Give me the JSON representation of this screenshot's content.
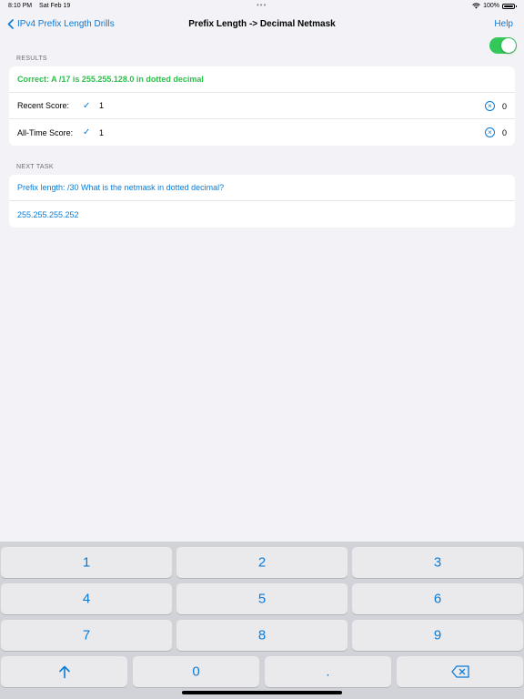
{
  "status_bar": {
    "time": "8:10 PM",
    "date": "Sat Feb 19",
    "battery": "100%"
  },
  "nav": {
    "back_label": "IPv4 Prefix Length Drills",
    "title": "Prefix Length -> Decimal Netmask",
    "help_label": "Help"
  },
  "toggle": {
    "on": true,
    "color": "#34c759"
  },
  "results": {
    "header": "RESULTS",
    "correct_message": "Correct: A /17 is 255.255.128.0 in dotted decimal",
    "recent_label": "Recent Score:",
    "recent_correct": "1",
    "recent_wrong": "0",
    "alltime_label": "All-Time Score:",
    "alltime_correct": "1",
    "alltime_wrong": "0"
  },
  "next_task": {
    "header": "NEXT TASK",
    "question": "Prefix length: /30 What is the netmask in dotted decimal?",
    "answer": "255.255.255.252"
  },
  "keyboard": {
    "keys": [
      "1",
      "2",
      "3",
      "4",
      "5",
      "6",
      "7",
      "8",
      "9",
      "0",
      "."
    ],
    "up_icon": "arrow-up-icon",
    "delete_icon": "delete-backspace-icon"
  },
  "colors": {
    "accent": "#0a7bd8",
    "success": "#2dbf4c",
    "background": "#f2f2f7"
  }
}
